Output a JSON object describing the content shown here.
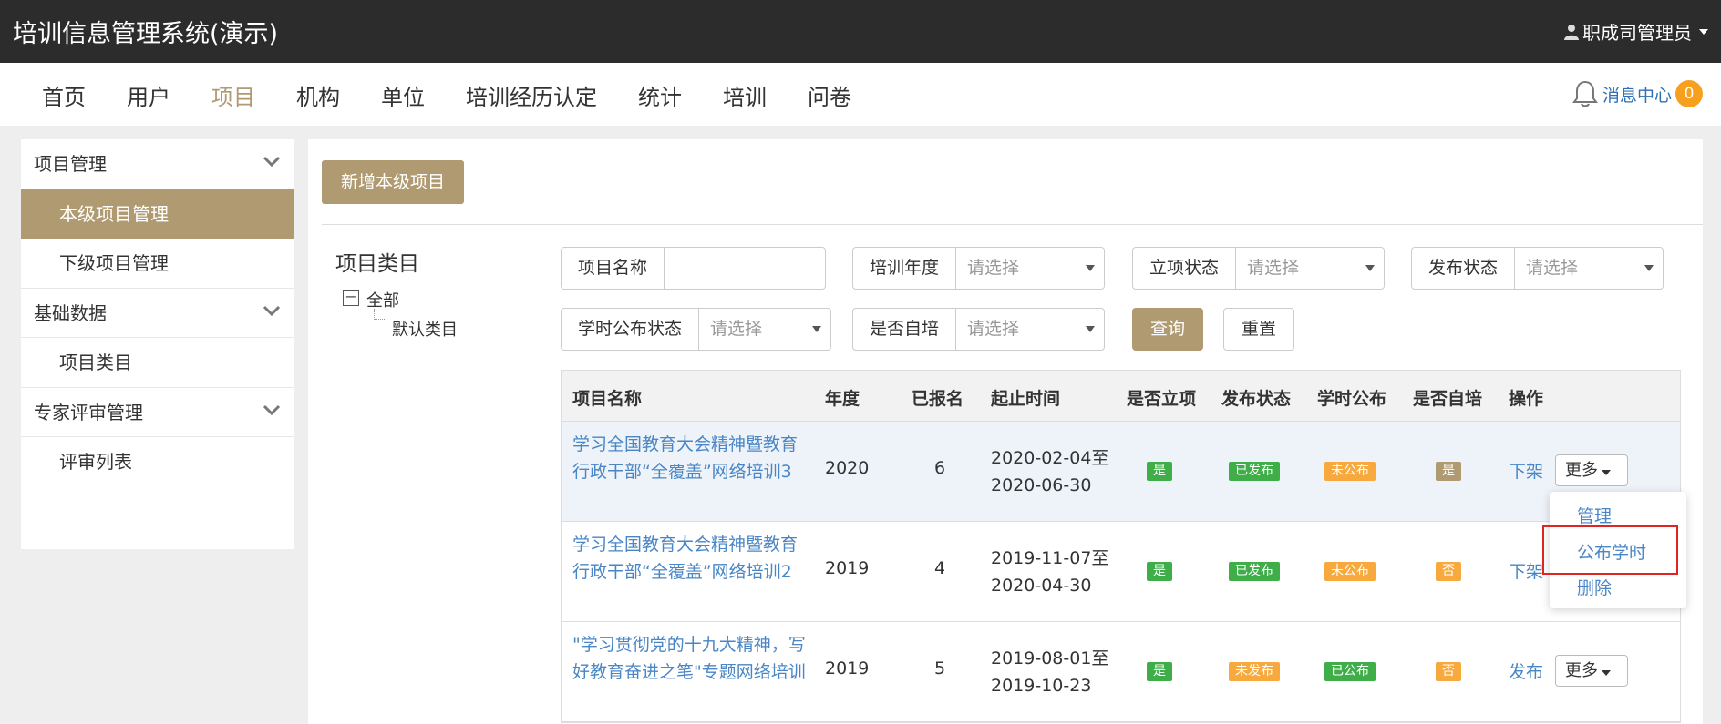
{
  "app": {
    "title": "培训信息管理系统(演示)",
    "user": "职成司管理员"
  },
  "nav": {
    "items": [
      "首页",
      "用户",
      "项目",
      "机构",
      "单位",
      "培训经历认定",
      "统计",
      "培训",
      "问卷"
    ],
    "active_index": 2,
    "message_center": "消息中心",
    "message_count": "0"
  },
  "sidebar": {
    "groups": [
      {
        "label": "项目管理",
        "items": [
          "本级项目管理",
          "下级项目管理"
        ]
      },
      {
        "label": "基础数据",
        "items": [
          "项目类目"
        ]
      },
      {
        "label": "专家评审管理",
        "items": [
          "评审列表"
        ]
      }
    ],
    "active_item": "本级项目管理"
  },
  "toolbar": {
    "add_label": "新增本级项目"
  },
  "category": {
    "title": "项目类目",
    "root": "全部",
    "child": "默认类目"
  },
  "filters": {
    "project_name": {
      "label": "项目名称",
      "value": ""
    },
    "year": {
      "label": "培训年度",
      "placeholder": "请选择"
    },
    "approval": {
      "label": "立项状态",
      "placeholder": "请选择"
    },
    "publish": {
      "label": "发布状态",
      "placeholder": "请选择"
    },
    "hours_publish": {
      "label": "学时公布状态",
      "placeholder": "请选择"
    },
    "self_train": {
      "label": "是否自培",
      "placeholder": "请选择"
    },
    "query_label": "查询",
    "reset_label": "重置"
  },
  "table": {
    "headers": [
      "项目名称",
      "年度",
      "已报名",
      "起止时间",
      "是否立项",
      "发布状态",
      "学时公布",
      "是否自培",
      "操作"
    ],
    "rows": [
      {
        "name": "学习全国教育大会精神暨教育行政干部“全覆盖”网络培训3",
        "year": "2020",
        "enrolled": "6",
        "start": "2020-02-04至",
        "end": "2020-06-30",
        "approved": "是",
        "publish": "已发布",
        "hours": "未公布",
        "self": "是",
        "action": "下架",
        "more": "更多"
      },
      {
        "name": "学习全国教育大会精神暨教育行政干部“全覆盖”网络培训2",
        "year": "2019",
        "enrolled": "4",
        "start": "2019-11-07至",
        "end": "2020-04-30",
        "approved": "是",
        "publish": "已发布",
        "hours": "未公布",
        "self": "否",
        "action": "下架",
        "more": "更多"
      },
      {
        "name": "\"学习贯彻党的十九大精神，写好教育奋进之笔\"专题网络培训",
        "year": "2019",
        "enrolled": "5",
        "start": "2019-08-01至",
        "end": "2019-10-23",
        "approved": "是",
        "publish": "未发布",
        "hours": "已公布",
        "self": "否",
        "action": "发布",
        "more": "更多"
      }
    ]
  },
  "dropdown": {
    "items": [
      "管理",
      "公布学时",
      "删除"
    ],
    "highlighted": "公布学时"
  },
  "colors": {
    "accent": "#b09a72",
    "link": "#4a86c5",
    "green": "#3fae49",
    "orange": "#f7a93e",
    "highlight": "#e02424"
  }
}
